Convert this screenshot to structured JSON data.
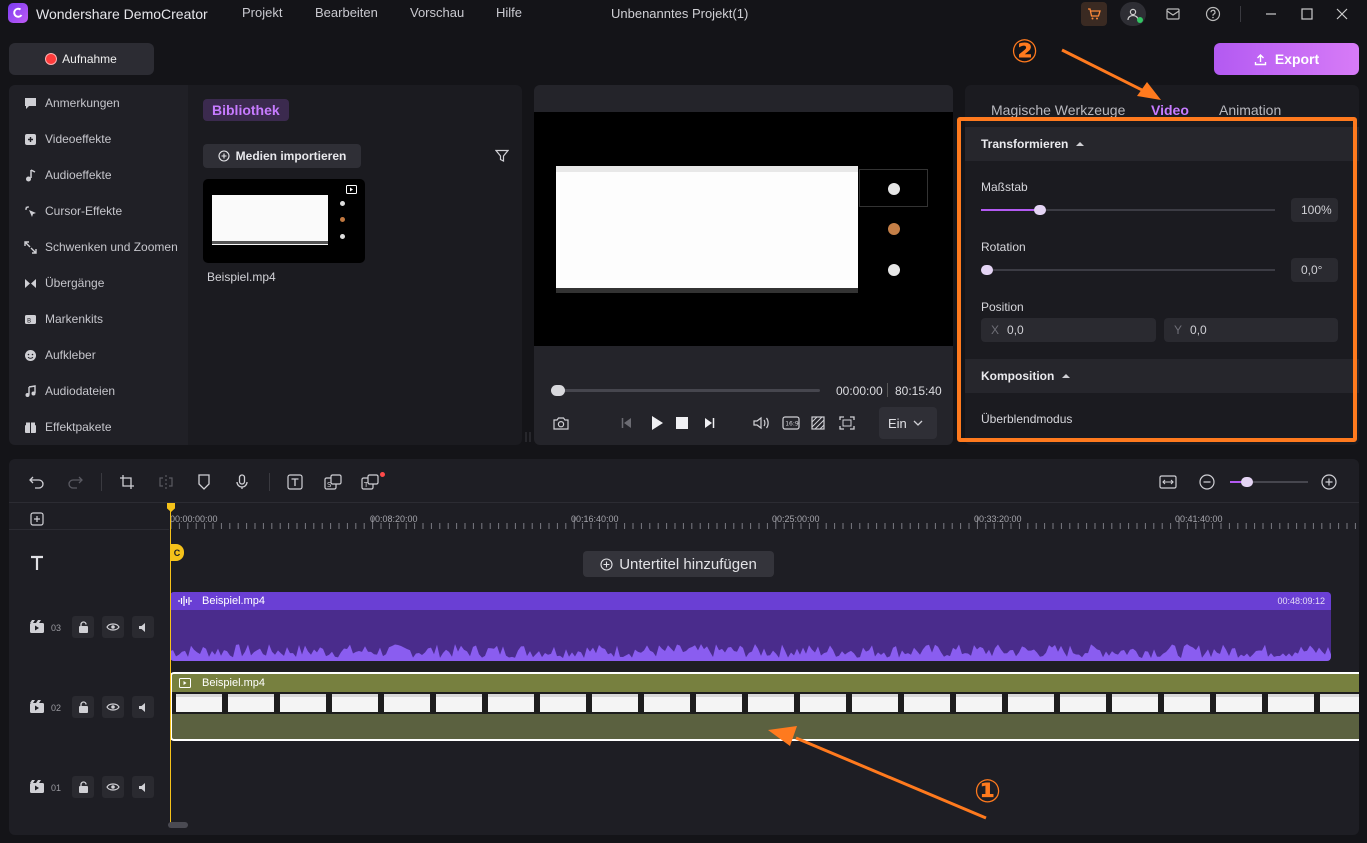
{
  "app": {
    "name": "Wondershare DemoCreator",
    "menu": [
      "Projekt",
      "Bearbeiten",
      "Vorschau",
      "Hilfe"
    ],
    "project_title": "Unbenanntes Projekt(1)"
  },
  "toolbar": {
    "record_label": "Aufnahme",
    "export_label": "Export"
  },
  "sidebar": {
    "items": [
      {
        "label": "Anmerkungen",
        "icon": "comment-icon"
      },
      {
        "label": "Videoeffekte",
        "icon": "video-effects-icon"
      },
      {
        "label": "Audioeffekte",
        "icon": "music-note-icon"
      },
      {
        "label": "Cursor-Effekte",
        "icon": "cursor-icon"
      },
      {
        "label": "Schwenken und Zoomen",
        "icon": "pan-zoom-icon"
      },
      {
        "label": "Übergänge",
        "icon": "transition-icon"
      },
      {
        "label": "Markenkits",
        "icon": "brand-kit-icon"
      },
      {
        "label": "Aufkleber",
        "icon": "sticker-icon"
      },
      {
        "label": "Audiodateien",
        "icon": "audio-file-icon"
      },
      {
        "label": "Effektpakete",
        "icon": "effect-pack-icon"
      }
    ]
  },
  "library": {
    "tab_label": "Bibliothek",
    "import_label": "Medien importieren",
    "media": [
      {
        "name": "Beispiel.mp4"
      }
    ]
  },
  "preview": {
    "current_time": "00:00:00",
    "total_time": "80:15:40",
    "fit_label": "Ein",
    "progress": 0.0
  },
  "properties": {
    "tabs": [
      "Magische Werkzeuge",
      "Video",
      "Animation"
    ],
    "active_tab": "Video",
    "transform_heading": "Transformieren",
    "scale_label": "Maßstab",
    "scale_value": "100%",
    "scale_level": 0.2,
    "rotation_label": "Rotation",
    "rotation_value": "0,0°",
    "rotation_level": 0.0,
    "position_label": "Position",
    "pos_x_label": "X",
    "pos_x_value": "0,0",
    "pos_y_label": "Y",
    "pos_y_value": "0,0",
    "composition_heading": "Komposition",
    "blend_label": "Überblendmodus"
  },
  "timeline": {
    "ruler": [
      "00:00:00:00",
      "00:08:20:00",
      "00:16:40:00",
      "00:25:00:00",
      "00:33:20:00",
      "00:41:40:00"
    ],
    "subtitle_label": "Untertitel hinzufügen",
    "tracks": [
      {
        "number": "03",
        "clip_name": "Beispiel.mp4",
        "clip_duration": "00:48:09:12",
        "kind": "audio"
      },
      {
        "number": "02",
        "clip_name": "Beispiel.mp4",
        "kind": "video"
      },
      {
        "number": "01",
        "kind": "empty"
      }
    ]
  },
  "annotations": {
    "marker_1": "①",
    "marker_2": "②"
  },
  "colors": {
    "accent": "#b35af2",
    "audio_clip": "#6a3fd4",
    "video_clip": "#77803f",
    "annotation": "#ff7a1e",
    "playhead": "#f5c21a"
  }
}
